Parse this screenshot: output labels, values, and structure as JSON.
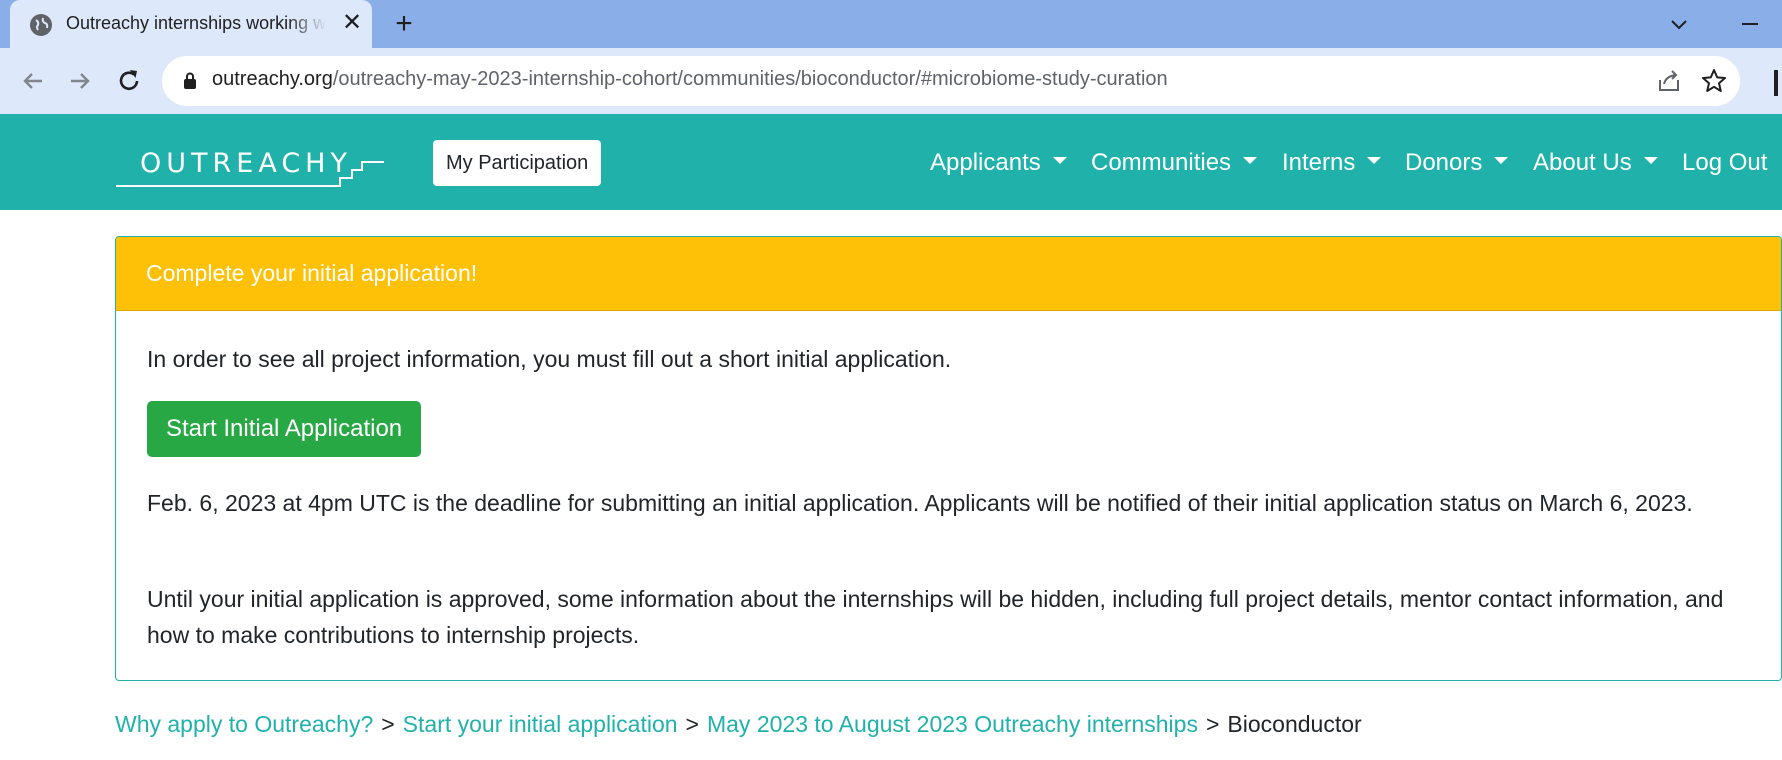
{
  "browser": {
    "tab_title": "Outreachy internships working with Bioconductor",
    "close_glyph": "✕",
    "newtab_glyph": "+",
    "url_host": "outreachy.org",
    "url_path": "/outreachy-may-2023-internship-cohort/communities/bioconductor/#microbiome-study-curation"
  },
  "navbar": {
    "logo": "OUTREACHY",
    "my_participation": "My Participation",
    "items": [
      "Applicants",
      "Communities",
      "Interns",
      "Donors",
      "About Us"
    ],
    "logout": "Log Out"
  },
  "alert": {
    "title": "Complete your initial application!",
    "intro": "In order to see all project information, you must fill out a short initial application.",
    "button": "Start Initial Application",
    "deadline": "Feb. 6, 2023 at 4pm UTC is the deadline for submitting an initial application. Applicants will be notified of their initial application status on March 6, 2023.",
    "hidden_info": "Until your initial application is approved, some information about the internships will be hidden, including full project details, mentor contact information, and how to make contributions to internship projects."
  },
  "breadcrumb": {
    "links": [
      "Why apply to Outreachy?",
      "Start your initial application",
      "May 2023 to August 2023 Outreachy internships"
    ],
    "separator": ">",
    "current": "Bioconductor"
  },
  "colors": {
    "brand_teal": "#20b2aa",
    "warning_yellow": "#ffc107",
    "success_green": "#28a745"
  }
}
